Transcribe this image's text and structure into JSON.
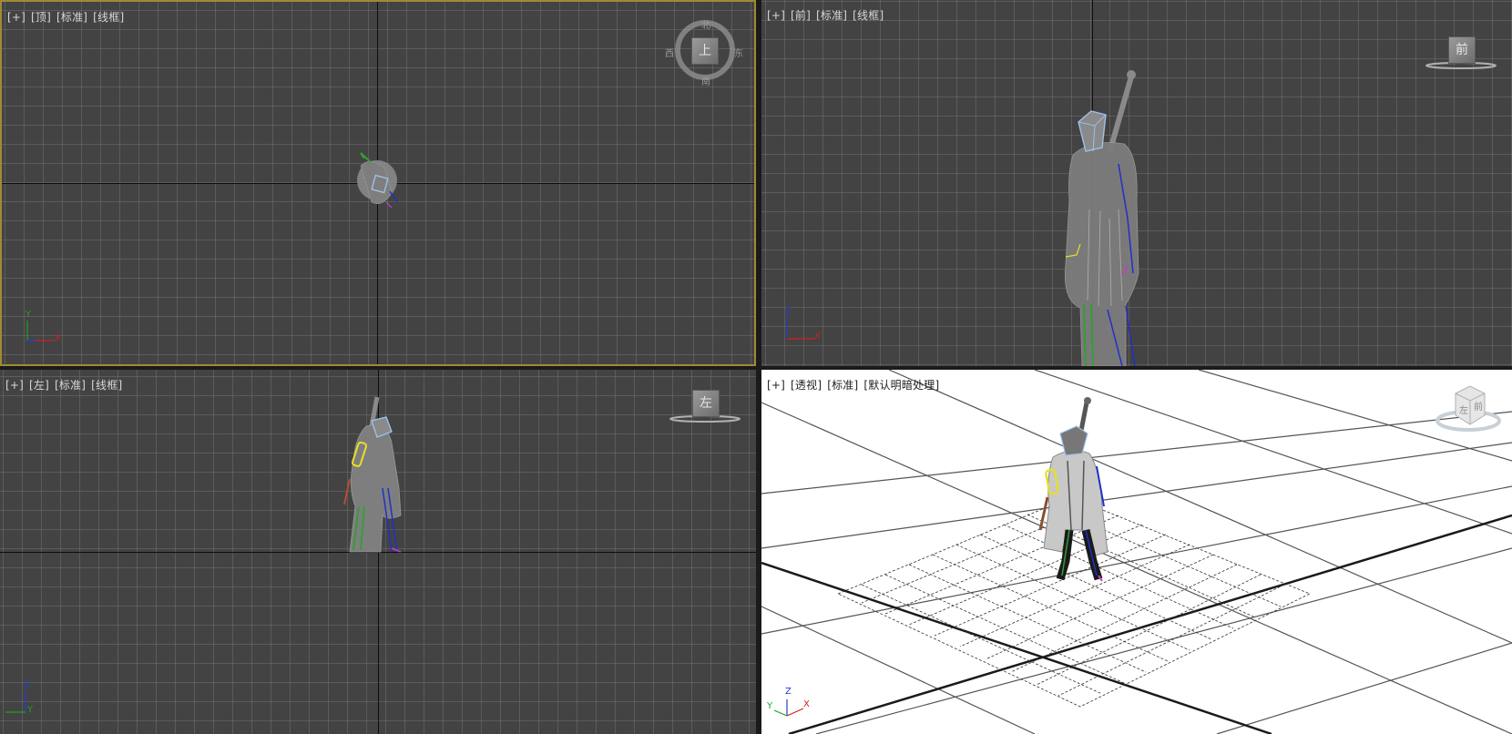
{
  "viewports": {
    "top": {
      "label": {
        "plus": "[+]",
        "view": "[顶]",
        "shading": "[标准]",
        "mode": "[线框]"
      },
      "viewcube": {
        "face": "上",
        "north": "北",
        "south": "南",
        "east": "东",
        "west": "西"
      },
      "gizmo": {
        "axis1": "Y",
        "axis2": "X"
      },
      "active": true
    },
    "front": {
      "label": {
        "plus": "[+]",
        "view": "[前]",
        "shading": "[标准]",
        "mode": "[线框]"
      },
      "viewcube": {
        "face": "前"
      },
      "gizmo": {
        "axis1": "Z",
        "axis2": "X"
      }
    },
    "left": {
      "label": {
        "plus": "[+]",
        "view": "[左]",
        "shading": "[标准]",
        "mode": "[线框]"
      },
      "viewcube": {
        "face": "左"
      },
      "gizmo": {
        "axis1": "Z",
        "axis2": "Y"
      }
    },
    "perspective": {
      "label": {
        "plus": "[+]",
        "view": "[透视]",
        "shading": "[标准]",
        "mode": "[默认明暗处理]"
      },
      "viewcube": {
        "face": "前",
        "side": "左"
      },
      "gizmo": {
        "axis1": "Z",
        "axis2": "Y",
        "axis3": "X"
      }
    }
  },
  "colors": {
    "active_border": "#a18a32",
    "viewport_bg": "#434343",
    "grid_line": "#787878",
    "persp_bg": "#ffffff",
    "character_gray": "#8a8a8a",
    "bone_blue": "#2030c8",
    "bone_green": "#30a030",
    "bone_yellow": "#e8e020",
    "head_box": "#9ec0e8",
    "axis_red": "#d02020",
    "axis_green": "#20a020",
    "axis_blue": "#2040d0"
  }
}
